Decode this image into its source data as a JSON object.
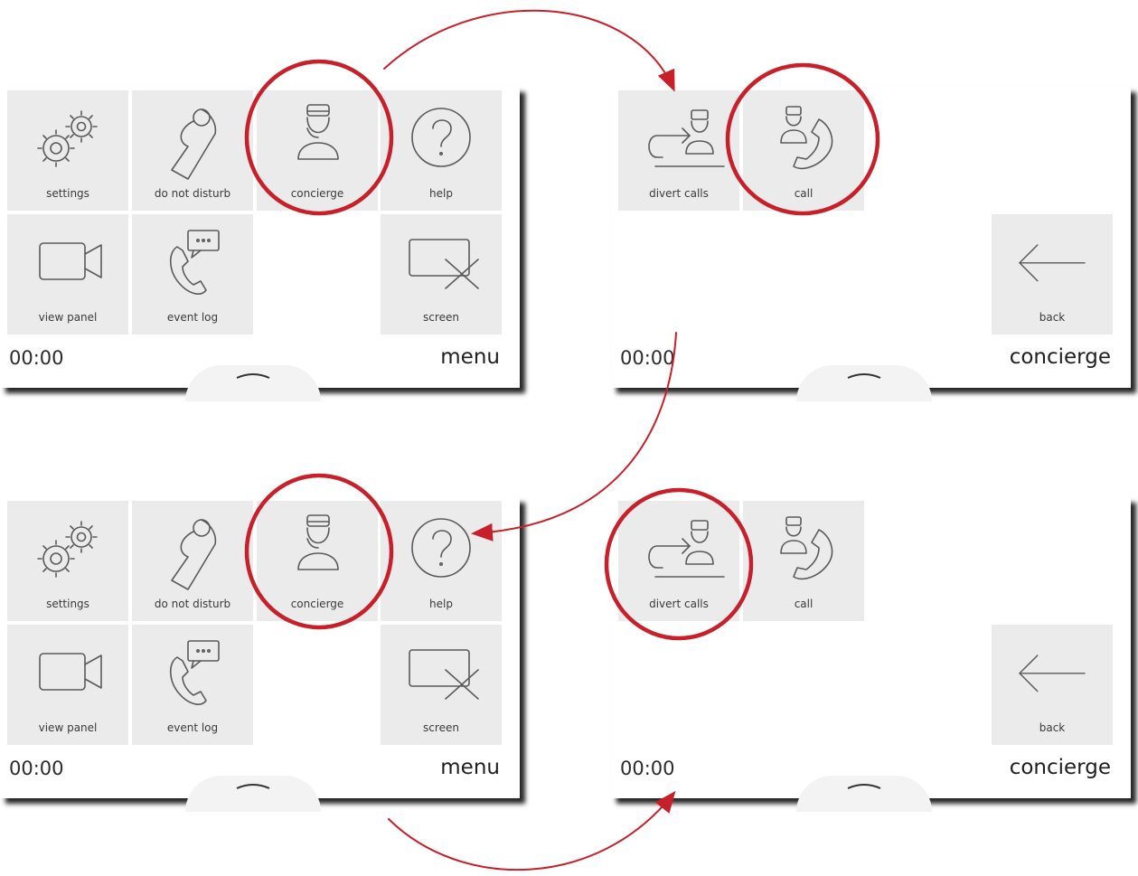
{
  "screens": [
    {
      "time": "00:00",
      "title": "menu",
      "tiles": [
        {
          "label": "settings",
          "icon": "gears-icon"
        },
        {
          "label": "do not disturb",
          "icon": "door-hanger-icon"
        },
        {
          "label": "concierge",
          "icon": "concierge-icon"
        },
        {
          "label": "help",
          "icon": "question-icon"
        },
        {
          "label": "view panel",
          "icon": "video-camera-icon"
        },
        {
          "label": "event log",
          "icon": "phone-message-icon"
        },
        {
          "label": "screen",
          "icon": "screen-off-icon"
        }
      ]
    },
    {
      "time": "00:00",
      "title": "concierge",
      "tiles": [
        {
          "label": "divert calls",
          "icon": "divert-calls-icon"
        },
        {
          "label": "call",
          "icon": "call-concierge-icon"
        },
        {
          "label": "back",
          "icon": "back-arrow-icon"
        }
      ]
    },
    {
      "time": "00:00",
      "title": "menu",
      "tiles": [
        {
          "label": "settings",
          "icon": "gears-icon"
        },
        {
          "label": "do not disturb",
          "icon": "door-hanger-icon"
        },
        {
          "label": "concierge",
          "icon": "concierge-icon"
        },
        {
          "label": "help",
          "icon": "question-icon"
        },
        {
          "label": "view panel",
          "icon": "video-camera-icon"
        },
        {
          "label": "event log",
          "icon": "phone-message-icon"
        },
        {
          "label": "screen",
          "icon": "screen-off-icon"
        }
      ]
    },
    {
      "time": "00:00",
      "title": "concierge",
      "tiles": [
        {
          "label": "divert calls",
          "icon": "divert-calls-icon"
        },
        {
          "label": "call",
          "icon": "call-concierge-icon"
        },
        {
          "label": "back",
          "icon": "back-arrow-icon"
        }
      ]
    }
  ],
  "colors": {
    "tile_bg": "#ebebeb",
    "icon_stroke": "#5a5a5a",
    "annotation_red": "#c8202a"
  }
}
